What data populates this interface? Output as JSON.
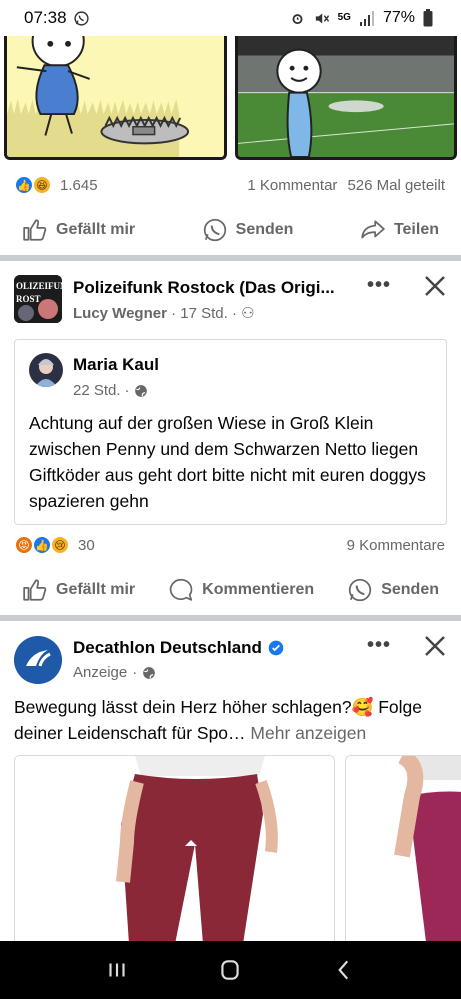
{
  "status_bar": {
    "time": "07:38",
    "network": "5G",
    "battery": "77%"
  },
  "post1": {
    "reaction_count": "1.645",
    "comments": "1 Kommentar",
    "shares": "526 Mal geteilt",
    "actions": {
      "like": "Gefällt mir",
      "send": "Senden",
      "share": "Teilen"
    }
  },
  "post2": {
    "page_name": "Polizeifunk Rostock (Das Origi...",
    "author": "Lucy Wegner",
    "time": "17 Std.",
    "shared": {
      "name": "Maria Kaul",
      "time": "22 Std.",
      "text": "Achtung auf der großen Wiese in Groß Klein zwischen Penny und dem Schwarzen Netto liegen Giftköder aus geht dort bitte nicht mit euren doggys spazieren gehn"
    },
    "reaction_count": "30",
    "comments": "9 Kommentare",
    "actions": {
      "like": "Gefällt mir",
      "comment": "Kommentieren",
      "send": "Senden"
    }
  },
  "post3": {
    "page_name": "Decathlon Deutschland",
    "sponsored": "Anzeige",
    "text": "Bewegung lässt dein Herz höher schlagen?🥰 Folge deiner Leidenschaft für Spo…",
    "more": "Mehr anzeigen"
  },
  "icons": [
    "whatsapp-icon",
    "alarm-icon",
    "mute-icon",
    "signal-icon",
    "battery-icon",
    "like-icon",
    "send-icon",
    "share-icon",
    "more-icon",
    "close-icon",
    "globe-icon",
    "comment-icon",
    "verified-icon",
    "recent-apps-icon",
    "home-icon",
    "back-icon"
  ],
  "colors": {
    "facebook_blue": "#1877f2",
    "text_secondary": "#65676b",
    "separator": "#c9ccd1"
  }
}
